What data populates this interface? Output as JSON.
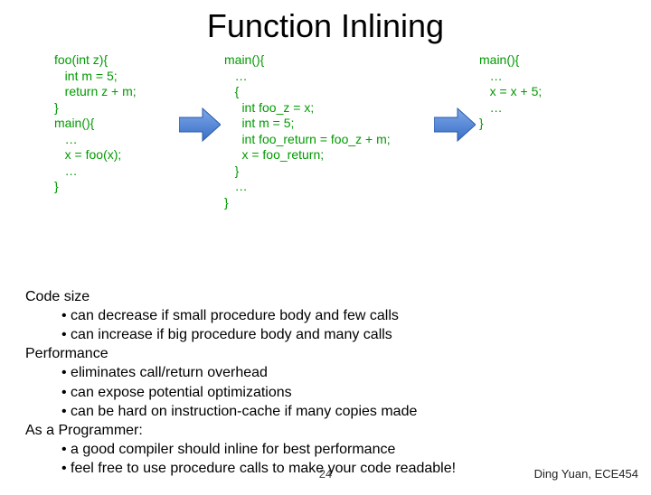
{
  "title": "Function Inlining",
  "code": {
    "col1": "foo(int z){\n   int m = 5;\n   return z + m;\n}\nmain(){\n   …\n   x = foo(x);\n   …\n}",
    "col2": "main(){\n   …\n   {\n     int foo_z = x;\n     int m = 5;\n     int foo_return = foo_z + m;\n     x = foo_return;\n   }\n   …\n}",
    "col3": "main(){\n   …\n   x = x + 5;\n   …\n}"
  },
  "notes": {
    "h1": "Code size",
    "b1": "• can decrease if small procedure body and few calls",
    "b2": "• can increase if big procedure body and many calls",
    "h2": "Performance",
    "b3": "• eliminates call/return overhead",
    "b4": "• can expose potential optimizations",
    "b5": "• can be hard on instruction-cache if many copies made",
    "h3": "As a Programmer:",
    "b6": "• a good compiler should inline for best performance",
    "b7": "• feel free to use procedure calls to make your code readable!"
  },
  "page_number": "24",
  "footer": "Ding Yuan, ECE454"
}
